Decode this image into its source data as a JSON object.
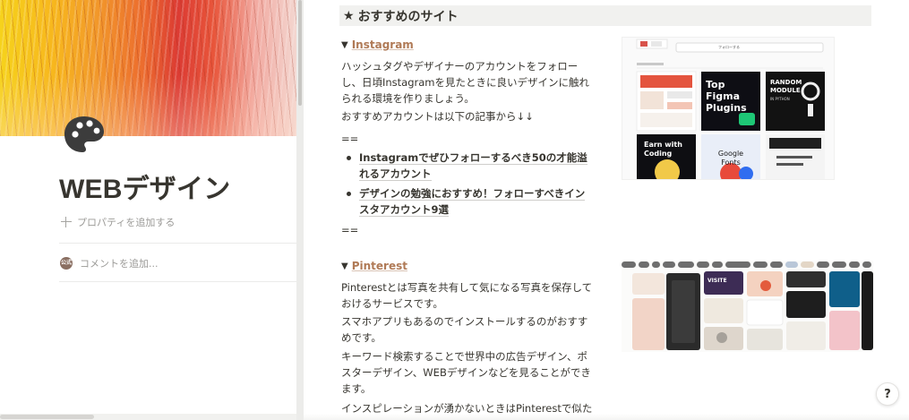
{
  "page": {
    "title": "WEBデザイン",
    "add_property": "プロパティを追加する",
    "add_comment": "コメントを追加...",
    "avatar_text": "公式"
  },
  "section": {
    "title": "おすすめのサイト"
  },
  "instagram": {
    "heading": "Instagram",
    "para1": "ハッシュタグやデザイナーのアカウントをフォローし、日頃Instagramを見たときに良いデザインに触れられる環境を作りましょう。",
    "para2": "おすすめアカウントは以下の記事から↓↓",
    "separator": "==",
    "links": [
      "Instagramでぜひフォローするべき50の才能溢れるアカウント",
      "デザインの勉強におすすめ！フォローすべきインスタアカウント9選"
    ],
    "separator2": "==",
    "thumb": {
      "follow_label": "フォローする",
      "tile2_title": "Top Figma Plugins",
      "tile3_title": "RANDOM MODULE IN PYTHON",
      "tile5_title": "Earn with Coding",
      "tile6_title": "Google Fonts"
    }
  },
  "pinterest": {
    "heading": "Pinterest",
    "para1": "Pinterestとは写真を共有して気になる写真を保存しておけるサービスです。",
    "para2": "スマホアプリもあるのでインストールするのがおすすめです。",
    "para3": "キーワード検索することで世界中の広告デザイン、ポスターデザイン、WEBデザインなどを見ることができます。",
    "para4": "インスピレーションが湧かないときはPinterestで似た"
  },
  "help": {
    "label": "?"
  },
  "colors": {
    "text": "#37352f",
    "muted": "#9b9a97",
    "link_brown": "#b07a56",
    "section_bg": "#f1f1ef"
  }
}
